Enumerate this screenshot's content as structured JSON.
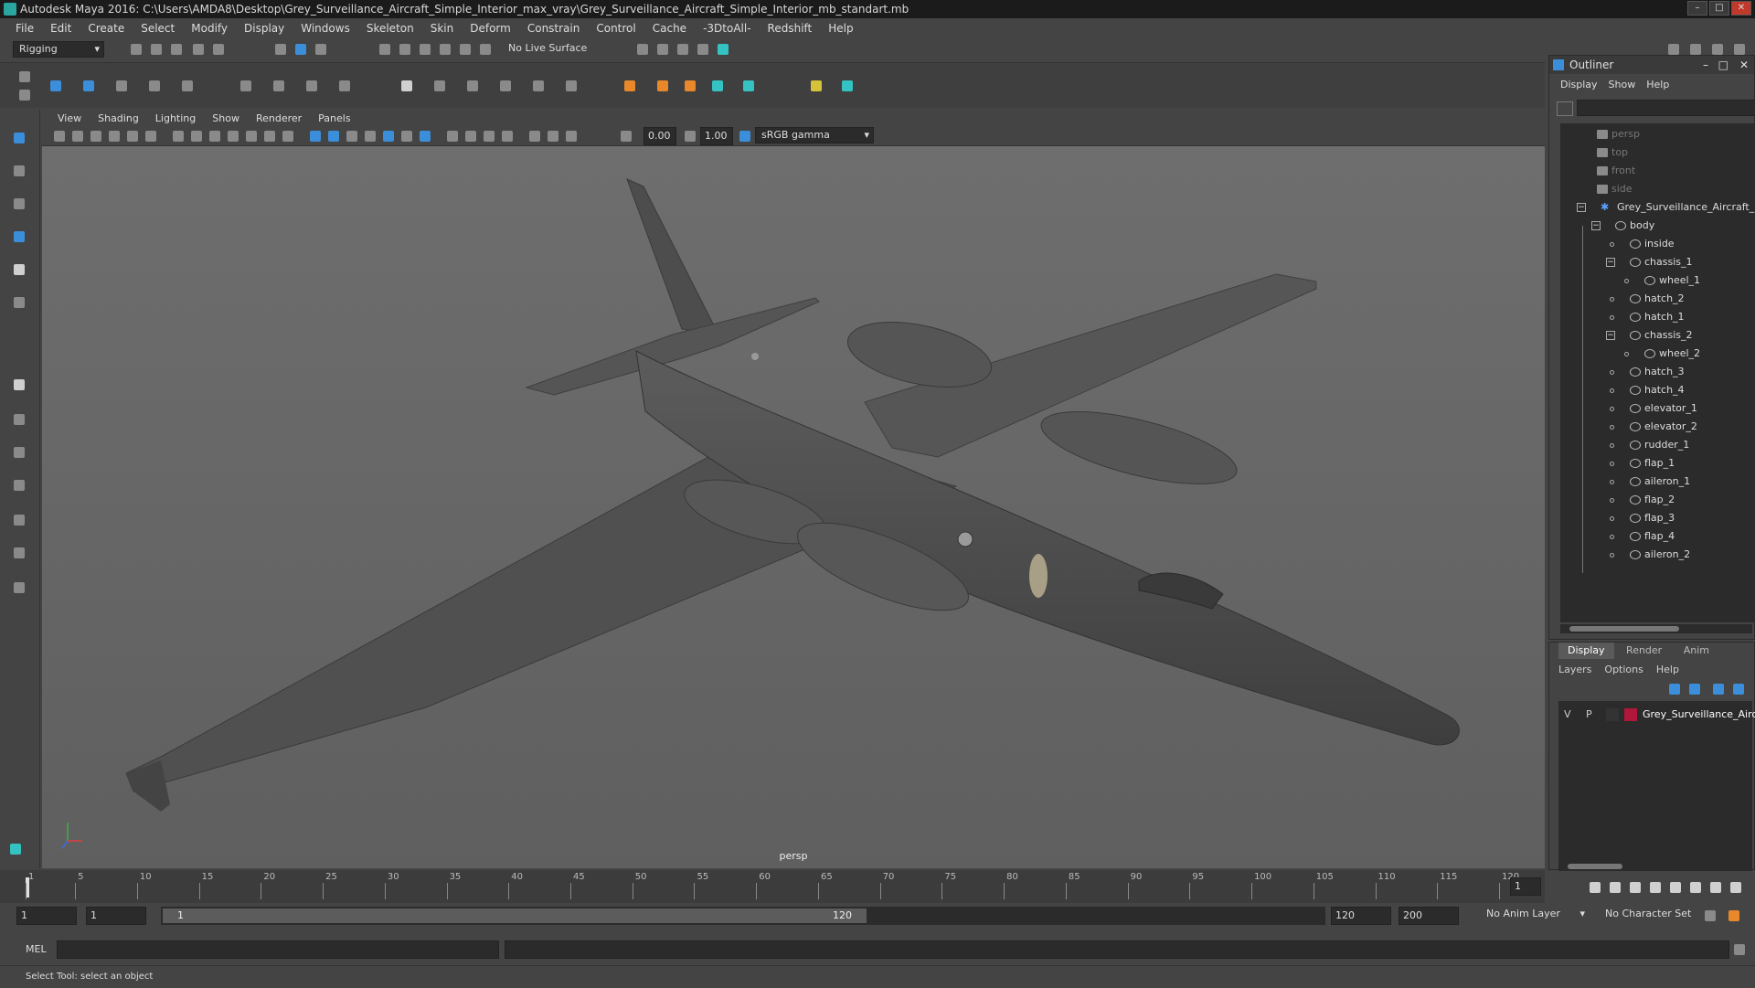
{
  "window": {
    "title": "Autodesk Maya 2016: C:\\Users\\AMDA8\\Desktop\\Grey_Surveillance_Aircraft_Simple_Interior_max_vray\\Grey_Surveillance_Aircraft_Simple_Interior_mb_standart.mb"
  },
  "menubar": [
    "File",
    "Edit",
    "Create",
    "Select",
    "Modify",
    "Display",
    "Windows",
    "Skeleton",
    "Skin",
    "Deform",
    "Constrain",
    "Control",
    "Cache",
    "-3DtoAll-",
    "Redshift",
    "Help"
  ],
  "shelf": {
    "mode": "Rigging",
    "live_surface": "No Live Surface"
  },
  "viewport": {
    "menus": [
      "View",
      "Shading",
      "Lighting",
      "Show",
      "Renderer",
      "Panels"
    ],
    "exposure": "0.00",
    "gamma": "1.00",
    "color_space": "sRGB gamma",
    "camera_label": "persp"
  },
  "timeline": {
    "ticks": [
      "1",
      "5",
      "10",
      "15",
      "20",
      "25",
      "30",
      "35",
      "40",
      "45",
      "50",
      "55",
      "60",
      "65",
      "70",
      "75",
      "80",
      "85",
      "90",
      "95",
      "100",
      "105",
      "110",
      "115",
      "120"
    ],
    "current_frame": "1"
  },
  "range": {
    "start": "1",
    "playback_start": "1",
    "slider_start": "1",
    "slider_end": "120",
    "playback_end": "120",
    "end": "200",
    "anim_layer": "No Anim Layer",
    "character_set": "No Character Set"
  },
  "command": {
    "language": "MEL",
    "help_text": "Select Tool: select an object"
  },
  "outliner": {
    "title": "Outliner",
    "menus": [
      "Display",
      "Show",
      "Help"
    ],
    "items": [
      {
        "label": "persp",
        "kind": "camera",
        "dim": true
      },
      {
        "label": "top",
        "kind": "camera",
        "dim": true
      },
      {
        "label": "front",
        "kind": "camera",
        "dim": true
      },
      {
        "label": "side",
        "kind": "camera",
        "dim": true
      },
      {
        "label": "Grey_Surveillance_Aircraft_Si",
        "kind": "group",
        "dim": false
      },
      {
        "label": "body",
        "kind": "object",
        "dim": false
      },
      {
        "label": "inside",
        "kind": "object",
        "dim": false
      },
      {
        "label": "chassis_1",
        "kind": "object",
        "dim": false
      },
      {
        "label": "wheel_1",
        "kind": "object",
        "dim": false
      },
      {
        "label": "hatch_2",
        "kind": "object",
        "dim": false
      },
      {
        "label": "hatch_1",
        "kind": "object",
        "dim": false
      },
      {
        "label": "chassis_2",
        "kind": "object",
        "dim": false
      },
      {
        "label": "wheel_2",
        "kind": "object",
        "dim": false
      },
      {
        "label": "hatch_3",
        "kind": "object",
        "dim": false
      },
      {
        "label": "hatch_4",
        "kind": "object",
        "dim": false
      },
      {
        "label": "elevator_1",
        "kind": "object",
        "dim": false
      },
      {
        "label": "elevator_2",
        "kind": "object",
        "dim": false
      },
      {
        "label": "rudder_1",
        "kind": "object",
        "dim": false
      },
      {
        "label": "flap_1",
        "kind": "object",
        "dim": false
      },
      {
        "label": "aileron_1",
        "kind": "object",
        "dim": false
      },
      {
        "label": "flap_2",
        "kind": "object",
        "dim": false
      },
      {
        "label": "flap_3",
        "kind": "object",
        "dim": false
      },
      {
        "label": "flap_4",
        "kind": "object",
        "dim": false
      },
      {
        "label": "aileron_2",
        "kind": "object",
        "dim": false
      }
    ]
  },
  "layers": {
    "tabs": [
      "Display",
      "Render",
      "Anim"
    ],
    "menus": [
      "Layers",
      "Options",
      "Help"
    ],
    "layer": {
      "v": "V",
      "p": "P",
      "name": "Grey_Surveillance_Airc",
      "color": "#b0173a"
    }
  }
}
